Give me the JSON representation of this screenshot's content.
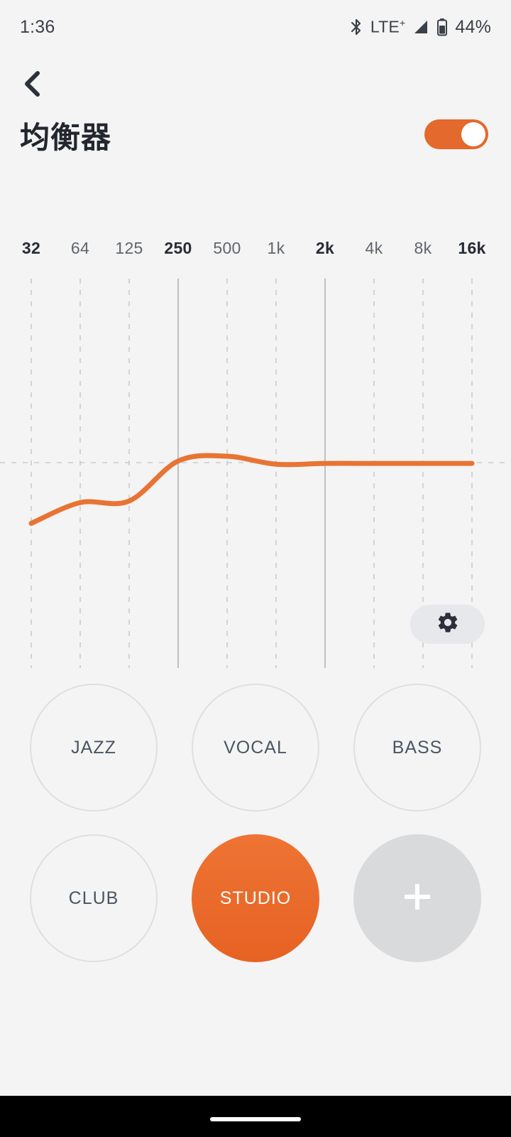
{
  "status_bar": {
    "time": "1:36",
    "bluetooth_icon": "bluetooth-icon",
    "network": "LTE",
    "network_sup": "+",
    "signal_icon": "signal-bars-icon",
    "battery_icon": "battery-icon",
    "battery_text": "44%"
  },
  "header": {
    "back_icon": "chevron-left-icon",
    "title": "均衡器",
    "toggle_name": "equalizer-enable-toggle",
    "toggle_state": "on"
  },
  "colors": {
    "accent": "#E3692C",
    "curve": "#E87434",
    "background": "#F3F4F3",
    "text_dark": "#23262E",
    "text_muted": "#60646C",
    "preset_label": "#4B5565",
    "grid": "#C9CBCE",
    "add_button_bg": "#D9DADC"
  },
  "chart_data": {
    "type": "line",
    "title": "",
    "xlabel": "",
    "ylabel": "",
    "grid": true,
    "legend": "none",
    "categories": [
      "32",
      "64",
      "125",
      "250",
      "500",
      "1k",
      "2k",
      "4k",
      "8k",
      "16k"
    ],
    "tick_emphasis": [
      true,
      false,
      false,
      true,
      false,
      false,
      true,
      false,
      false,
      true
    ],
    "major_gridlines": [
      "250",
      "2k"
    ],
    "zero_line": 0,
    "ylim": [
      -12,
      12
    ],
    "series": [
      {
        "name": "STUDIO",
        "color": "#E87434",
        "values": [
          -3.8,
          -2.5,
          -2.4,
          0.1,
          0.4,
          -0.1,
          -0.05,
          -0.05,
          -0.05,
          -0.05
        ]
      }
    ]
  },
  "settings_button": {
    "icon": "gear-icon",
    "name": "equalizer-settings-button"
  },
  "presets": {
    "rows": [
      [
        {
          "label": "JAZZ",
          "selected": false,
          "kind": "preset"
        },
        {
          "label": "VOCAL",
          "selected": false,
          "kind": "preset"
        },
        {
          "label": "BASS",
          "selected": false,
          "kind": "preset"
        }
      ],
      [
        {
          "label": "CLUB",
          "selected": false,
          "kind": "preset"
        },
        {
          "label": "STUDIO",
          "selected": true,
          "kind": "preset"
        },
        {
          "label": "",
          "selected": false,
          "kind": "add",
          "icon": "plus-icon"
        }
      ]
    ]
  },
  "nav_bar": {
    "home_indicator": "home-indicator"
  }
}
